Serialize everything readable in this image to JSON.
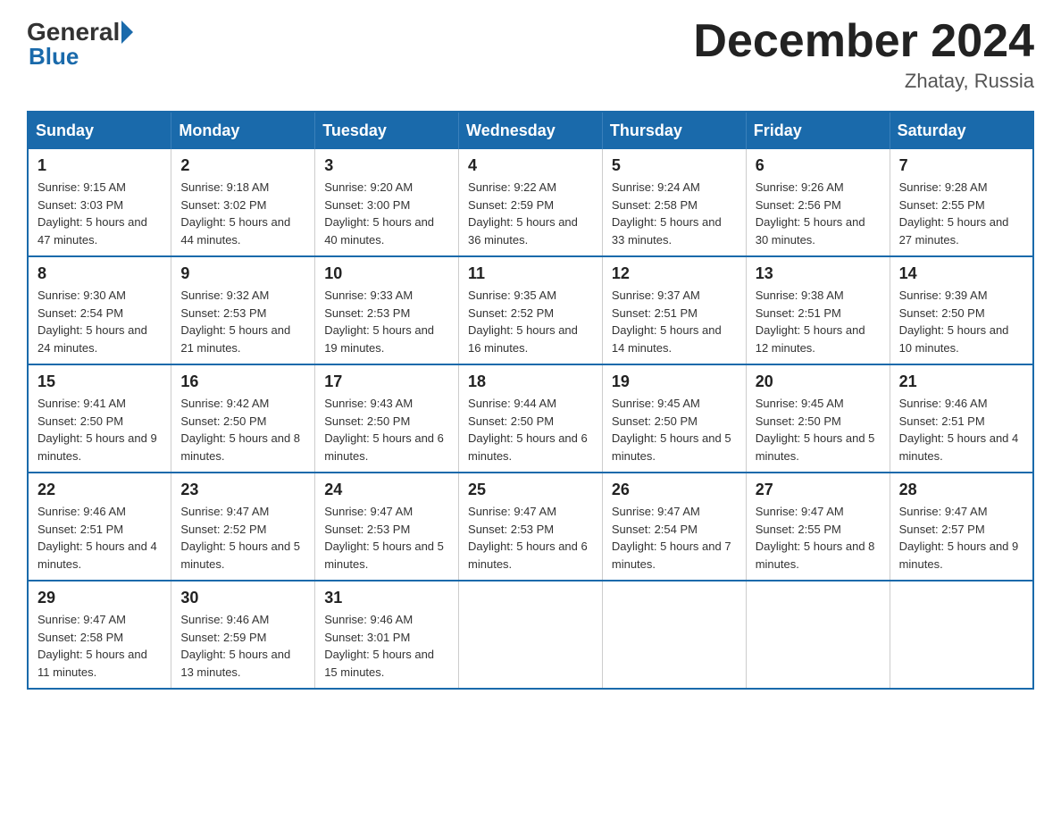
{
  "header": {
    "logo_general": "General",
    "logo_blue": "Blue",
    "month_title": "December 2024",
    "location": "Zhatay, Russia"
  },
  "calendar": {
    "days_of_week": [
      "Sunday",
      "Monday",
      "Tuesday",
      "Wednesday",
      "Thursday",
      "Friday",
      "Saturday"
    ],
    "weeks": [
      [
        {
          "date": "1",
          "sunrise": "Sunrise: 9:15 AM",
          "sunset": "Sunset: 3:03 PM",
          "daylight": "Daylight: 5 hours and 47 minutes."
        },
        {
          "date": "2",
          "sunrise": "Sunrise: 9:18 AM",
          "sunset": "Sunset: 3:02 PM",
          "daylight": "Daylight: 5 hours and 44 minutes."
        },
        {
          "date": "3",
          "sunrise": "Sunrise: 9:20 AM",
          "sunset": "Sunset: 3:00 PM",
          "daylight": "Daylight: 5 hours and 40 minutes."
        },
        {
          "date": "4",
          "sunrise": "Sunrise: 9:22 AM",
          "sunset": "Sunset: 2:59 PM",
          "daylight": "Daylight: 5 hours and 36 minutes."
        },
        {
          "date": "5",
          "sunrise": "Sunrise: 9:24 AM",
          "sunset": "Sunset: 2:58 PM",
          "daylight": "Daylight: 5 hours and 33 minutes."
        },
        {
          "date": "6",
          "sunrise": "Sunrise: 9:26 AM",
          "sunset": "Sunset: 2:56 PM",
          "daylight": "Daylight: 5 hours and 30 minutes."
        },
        {
          "date": "7",
          "sunrise": "Sunrise: 9:28 AM",
          "sunset": "Sunset: 2:55 PM",
          "daylight": "Daylight: 5 hours and 27 minutes."
        }
      ],
      [
        {
          "date": "8",
          "sunrise": "Sunrise: 9:30 AM",
          "sunset": "Sunset: 2:54 PM",
          "daylight": "Daylight: 5 hours and 24 minutes."
        },
        {
          "date": "9",
          "sunrise": "Sunrise: 9:32 AM",
          "sunset": "Sunset: 2:53 PM",
          "daylight": "Daylight: 5 hours and 21 minutes."
        },
        {
          "date": "10",
          "sunrise": "Sunrise: 9:33 AM",
          "sunset": "Sunset: 2:53 PM",
          "daylight": "Daylight: 5 hours and 19 minutes."
        },
        {
          "date": "11",
          "sunrise": "Sunrise: 9:35 AM",
          "sunset": "Sunset: 2:52 PM",
          "daylight": "Daylight: 5 hours and 16 minutes."
        },
        {
          "date": "12",
          "sunrise": "Sunrise: 9:37 AM",
          "sunset": "Sunset: 2:51 PM",
          "daylight": "Daylight: 5 hours and 14 minutes."
        },
        {
          "date": "13",
          "sunrise": "Sunrise: 9:38 AM",
          "sunset": "Sunset: 2:51 PM",
          "daylight": "Daylight: 5 hours and 12 minutes."
        },
        {
          "date": "14",
          "sunrise": "Sunrise: 9:39 AM",
          "sunset": "Sunset: 2:50 PM",
          "daylight": "Daylight: 5 hours and 10 minutes."
        }
      ],
      [
        {
          "date": "15",
          "sunrise": "Sunrise: 9:41 AM",
          "sunset": "Sunset: 2:50 PM",
          "daylight": "Daylight: 5 hours and 9 minutes."
        },
        {
          "date": "16",
          "sunrise": "Sunrise: 9:42 AM",
          "sunset": "Sunset: 2:50 PM",
          "daylight": "Daylight: 5 hours and 8 minutes."
        },
        {
          "date": "17",
          "sunrise": "Sunrise: 9:43 AM",
          "sunset": "Sunset: 2:50 PM",
          "daylight": "Daylight: 5 hours and 6 minutes."
        },
        {
          "date": "18",
          "sunrise": "Sunrise: 9:44 AM",
          "sunset": "Sunset: 2:50 PM",
          "daylight": "Daylight: 5 hours and 6 minutes."
        },
        {
          "date": "19",
          "sunrise": "Sunrise: 9:45 AM",
          "sunset": "Sunset: 2:50 PM",
          "daylight": "Daylight: 5 hours and 5 minutes."
        },
        {
          "date": "20",
          "sunrise": "Sunrise: 9:45 AM",
          "sunset": "Sunset: 2:50 PM",
          "daylight": "Daylight: 5 hours and 5 minutes."
        },
        {
          "date": "21",
          "sunrise": "Sunrise: 9:46 AM",
          "sunset": "Sunset: 2:51 PM",
          "daylight": "Daylight: 5 hours and 4 minutes."
        }
      ],
      [
        {
          "date": "22",
          "sunrise": "Sunrise: 9:46 AM",
          "sunset": "Sunset: 2:51 PM",
          "daylight": "Daylight: 5 hours and 4 minutes."
        },
        {
          "date": "23",
          "sunrise": "Sunrise: 9:47 AM",
          "sunset": "Sunset: 2:52 PM",
          "daylight": "Daylight: 5 hours and 5 minutes."
        },
        {
          "date": "24",
          "sunrise": "Sunrise: 9:47 AM",
          "sunset": "Sunset: 2:53 PM",
          "daylight": "Daylight: 5 hours and 5 minutes."
        },
        {
          "date": "25",
          "sunrise": "Sunrise: 9:47 AM",
          "sunset": "Sunset: 2:53 PM",
          "daylight": "Daylight: 5 hours and 6 minutes."
        },
        {
          "date": "26",
          "sunrise": "Sunrise: 9:47 AM",
          "sunset": "Sunset: 2:54 PM",
          "daylight": "Daylight: 5 hours and 7 minutes."
        },
        {
          "date": "27",
          "sunrise": "Sunrise: 9:47 AM",
          "sunset": "Sunset: 2:55 PM",
          "daylight": "Daylight: 5 hours and 8 minutes."
        },
        {
          "date": "28",
          "sunrise": "Sunrise: 9:47 AM",
          "sunset": "Sunset: 2:57 PM",
          "daylight": "Daylight: 5 hours and 9 minutes."
        }
      ],
      [
        {
          "date": "29",
          "sunrise": "Sunrise: 9:47 AM",
          "sunset": "Sunset: 2:58 PM",
          "daylight": "Daylight: 5 hours and 11 minutes."
        },
        {
          "date": "30",
          "sunrise": "Sunrise: 9:46 AM",
          "sunset": "Sunset: 2:59 PM",
          "daylight": "Daylight: 5 hours and 13 minutes."
        },
        {
          "date": "31",
          "sunrise": "Sunrise: 9:46 AM",
          "sunset": "Sunset: 3:01 PM",
          "daylight": "Daylight: 5 hours and 15 minutes."
        },
        null,
        null,
        null,
        null
      ]
    ]
  }
}
